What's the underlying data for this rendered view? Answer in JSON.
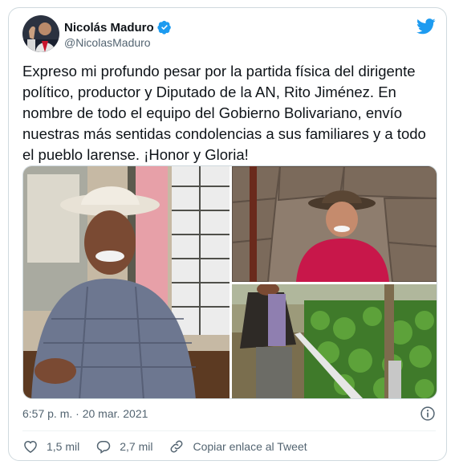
{
  "author": {
    "name": "Nicolás Maduro",
    "handle": "@NicolasMaduro",
    "verified": true
  },
  "tweet": {
    "text": "Expreso mi profundo pesar por la partida física del dirigente\npolítico, productor y Diputado de la AN, Rito Jiménez. En\nnombre de todo el equipo del Gobierno Bolivariano, envío\nnuestras más sentidas condolencias a sus familiares y a todo\nel pueblo larense. ¡Honor y Gloria!"
  },
  "media": {
    "photo_count": 3
  },
  "meta": {
    "timestamp": "6:57 p. m. · 20 mar. 2021"
  },
  "actions": {
    "likes": "1,5 mil",
    "replies": "2,7 mil",
    "copy_link": "Copiar enlace al Tweet"
  },
  "colors": {
    "twitter_blue": "#1d9bf0",
    "text_secondary": "#536471",
    "border": "#cfd9de"
  },
  "icons": [
    "twitter-bird-icon",
    "verified-badge-icon",
    "info-icon",
    "heart-icon",
    "reply-icon",
    "link-icon"
  ]
}
